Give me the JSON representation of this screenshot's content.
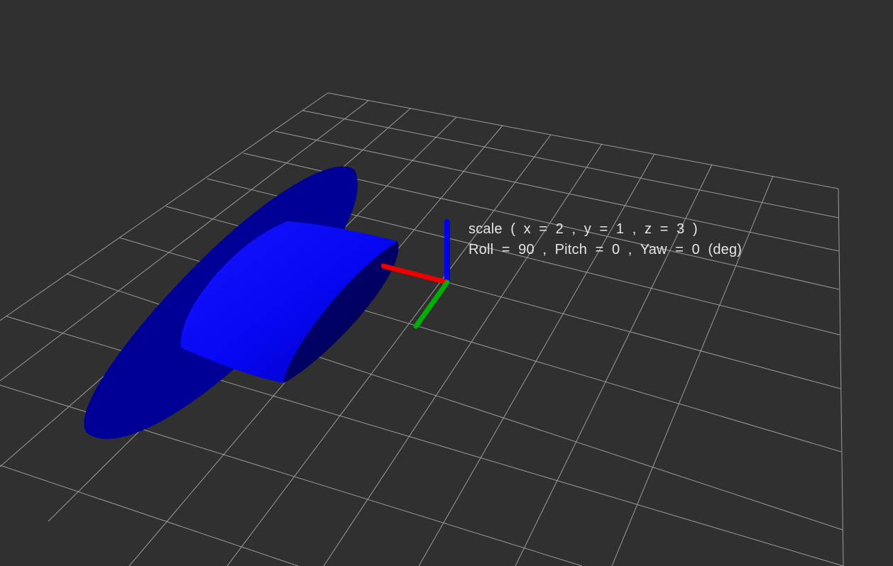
{
  "viewport": {
    "background_color": "#303030",
    "grid_color": "#a0a0a0"
  },
  "marker": {
    "shape": "cylinder",
    "color": "#0000ff",
    "scale_text": "scale  (  x  =  2  ,  y  =  1  ,  z  =  3  )",
    "orientation_text": "Roll  =  90  ,  Pitch  =  0  ,  Yaw  =  0  (deg)"
  },
  "axes": {
    "x_color": "#ff0000",
    "y_color": "#00b000",
    "z_color": "#0000ff"
  }
}
